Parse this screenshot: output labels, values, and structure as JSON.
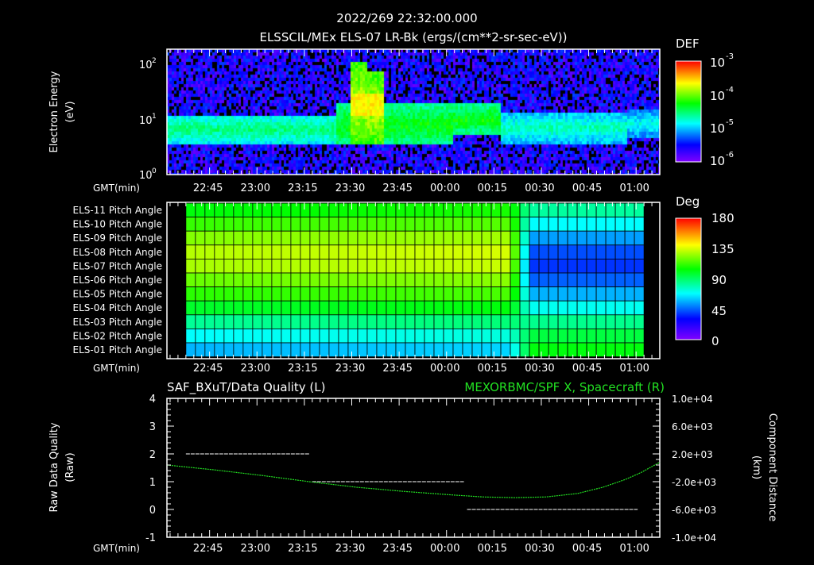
{
  "title": "2022/269 22:32:00.000",
  "chart_data": [
    {
      "type": "heatmap",
      "title": "ELSSCIL/MEx ELS-07 LR-Bk  (ergs/(cm**2-sr-sec-eV))",
      "ylabel": "Electron Energy",
      "yunits": "(eV)",
      "xlabel": "GMT(min)",
      "yscale": "log",
      "ylim": [
        1,
        185
      ],
      "y_ticks": [
        "10",
        "10",
        "10"
      ],
      "y_tick_exps": [
        "0",
        "1",
        "2"
      ],
      "x_ticks": [
        "22:45",
        "23:00",
        "23:15",
        "23:30",
        "23:45",
        "00:00",
        "00:15",
        "00:30",
        "00:45",
        "01:00"
      ],
      "time_range_min": [
        0,
        156
      ],
      "colorbar": {
        "label": "DEF",
        "ticks": [
          "10",
          "10",
          "10",
          "10"
        ],
        "tick_exps": [
          "-3",
          "-4",
          "-5",
          "-6"
        ],
        "range_log": [
          -6.2,
          -3
        ]
      }
    },
    {
      "type": "heatmap",
      "title": "Pitch Angle",
      "xlabel": "GMT(min)",
      "rows": [
        "ELS-11 Pitch Angle",
        "ELS-10 Pitch Angle",
        "ELS-09 Pitch Angle",
        "ELS-08 Pitch Angle",
        "ELS-07 Pitch Angle",
        "ELS-06 Pitch Angle",
        "ELS-05 Pitch Angle",
        "ELS-04 Pitch Angle",
        "ELS-03 Pitch Angle",
        "ELS-02 Pitch Angle",
        "ELS-01 Pitch Angle"
      ],
      "pitch_before_deg": [
        100,
        110,
        122,
        130,
        128,
        118,
        108,
        95,
        78,
        62,
        50
      ],
      "pitch_after_deg": [
        75,
        60,
        45,
        32,
        28,
        35,
        48,
        62,
        78,
        90,
        98
      ],
      "transition_min": 112,
      "data_start_min": 6,
      "data_end_min": 151,
      "x_ticks": [
        "22:45",
        "23:00",
        "23:15",
        "23:30",
        "23:45",
        "00:00",
        "00:15",
        "00:30",
        "00:45",
        "01:00"
      ],
      "colorbar": {
        "label": "Deg",
        "ticks": [
          "180",
          "135",
          "90",
          "45",
          "0"
        ],
        "range": [
          0,
          180
        ]
      }
    },
    {
      "type": "line",
      "title_left": "SAF_BXuT/Data Quality (L)",
      "title_right": "MEXORBMC/SPF X, Spacecraft (R)",
      "ylabel_left": "Raw Data Quality",
      "yunits_left": "(Raw)",
      "ylabel_right": "Component Distance",
      "yunits_right": "(km)",
      "xlabel": "GMT(min)",
      "ylim_left": [
        -1,
        4
      ],
      "ylim_right": [
        -10000,
        10000
      ],
      "left_ticks": [
        "4",
        "3",
        "2",
        "1",
        "0",
        "-1"
      ],
      "right_ticks": [
        "1.0e+04",
        "6.0e+03",
        "2.0e+03",
        "-2.0e+03",
        "-6.0e+03",
        "-1.0e+04"
      ],
      "x_ticks": [
        "22:45",
        "23:00",
        "23:15",
        "23:30",
        "23:45",
        "00:00",
        "00:15",
        "00:30",
        "00:45",
        "01:00"
      ],
      "quality_segments": [
        {
          "start_min": 6,
          "end_min": 45,
          "value": 2
        },
        {
          "start_min": 46,
          "end_min": 94,
          "value": 1
        },
        {
          "start_min": 95,
          "end_min": 149,
          "value": 0
        }
      ],
      "spacecraft_x_km": {
        "t_min": [
          0,
          15,
          30,
          45,
          60,
          75,
          90,
          100,
          110,
          120,
          130,
          138,
          145,
          150,
          156
        ],
        "values": [
          400,
          -300,
          -1100,
          -2000,
          -2800,
          -3400,
          -3900,
          -4200,
          -4300,
          -4200,
          -3700,
          -2800,
          -1700,
          -700,
          800
        ]
      }
    }
  ]
}
